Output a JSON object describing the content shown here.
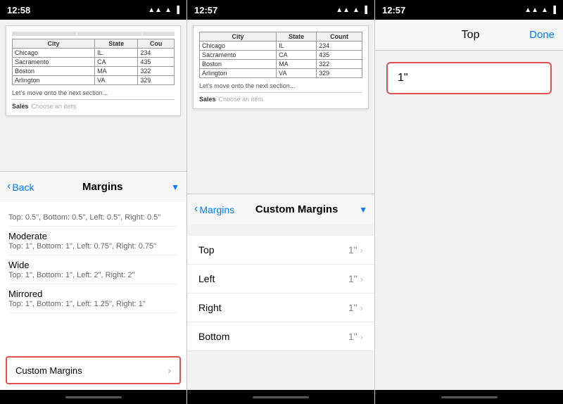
{
  "panel1": {
    "status": {
      "time": "12:58",
      "icons": "▲ ▲ ▲"
    },
    "table": {
      "headers": [
        "City",
        "State",
        "Cou"
      ],
      "rows": [
        [
          "Chicago",
          "IL",
          "234"
        ],
        [
          "Sacramento",
          "CA",
          "435"
        ],
        [
          "Boston",
          "MA",
          "322"
        ],
        [
          "Arlington",
          "VA",
          "329"
        ]
      ]
    },
    "doc_text": "Let's move onto the next section...",
    "dropdown_label": "Sales",
    "dropdown_placeholder": "Choose an item.",
    "nav": {
      "back_label": "Back",
      "title": "Margins",
      "has_dropdown": true
    },
    "margins_items": [
      {
        "title": "",
        "desc": "Top: 0.5\", Bottom: 0.5\", Left: 0.5\", Right: 0.5\""
      },
      {
        "title": "Moderate",
        "desc": "Top: 1\", Bottom: 1\", Left: 0.75\", Right: 0.75\""
      },
      {
        "title": "Wide",
        "desc": "Top: 1\", Bottom: 1\", Left: 2\", Right: 2\""
      },
      {
        "title": "Mirrored",
        "desc": "Top: 1\", Bottom: 1\", Left: 1.25\", Right: 1\""
      }
    ],
    "custom_margins_label": "Custom Margins",
    "custom_margins_chevron": "›"
  },
  "panel2": {
    "status": {
      "time": "12:57",
      "icons": "▲ ▲ ▲"
    },
    "table": {
      "headers": [
        "City",
        "State",
        "Count"
      ],
      "rows": [
        [
          "Chicago",
          "IL",
          "234"
        ],
        [
          "Sacramento",
          "CA",
          "435"
        ],
        [
          "Boston",
          "MA",
          "322"
        ],
        [
          "Arlington",
          "VA",
          "329"
        ]
      ]
    },
    "doc_text": "Let's move onto the next section...",
    "dropdown_label": "Sales",
    "dropdown_placeholder": "Choose an item.",
    "nav": {
      "back_label": "Margins",
      "title": "Custom Margins",
      "has_dropdown": true
    },
    "rows": [
      {
        "label": "Top",
        "value": "1\""
      },
      {
        "label": "Left",
        "value": "1\""
      },
      {
        "label": "Right",
        "value": "1\""
      },
      {
        "label": "Bottom",
        "value": "1\""
      }
    ]
  },
  "panel3": {
    "status": {
      "time": "12:57",
      "icons": "▲ ▲ ▲"
    },
    "nav": {
      "title": "Top",
      "done_label": "Done"
    },
    "input_value": "1\""
  }
}
